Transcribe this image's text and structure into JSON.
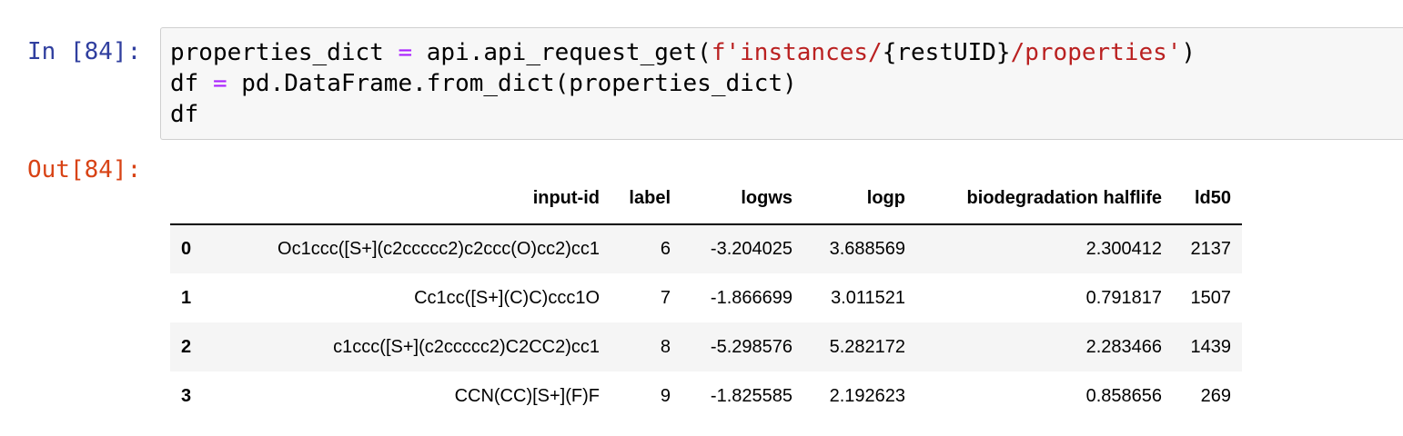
{
  "cell": {
    "in_prompt": "In [84]:",
    "out_prompt": "Out[84]:",
    "code_lines": [
      [
        {
          "t": "properties_dict ",
          "c": "plain"
        },
        {
          "t": "=",
          "c": "op"
        },
        {
          "t": " api.api_request_get(",
          "c": "plain"
        },
        {
          "t": "f'instances/",
          "c": "str"
        },
        {
          "t": "{restUID}",
          "c": "plain"
        },
        {
          "t": "/properties'",
          "c": "str"
        },
        {
          "t": ")",
          "c": "plain"
        }
      ],
      [
        {
          "t": "df ",
          "c": "plain"
        },
        {
          "t": "=",
          "c": "op"
        },
        {
          "t": " pd.DataFrame.from_dict(properties_dict)",
          "c": "plain"
        }
      ],
      [
        {
          "t": "df",
          "c": "plain"
        }
      ]
    ]
  },
  "output_table": {
    "columns": [
      "",
      "input-id",
      "label",
      "logws",
      "logp",
      "biodegradation halflife",
      "ld50"
    ],
    "rows": [
      {
        "index": "0",
        "cells": [
          "Oc1ccc([S+](c2ccccc2)c2ccc(O)cc2)cc1",
          "6",
          "-3.204025",
          "3.688569",
          "2.300412",
          "2137"
        ]
      },
      {
        "index": "1",
        "cells": [
          "Cc1cc([S+](C)C)ccc1O",
          "7",
          "-1.866699",
          "3.011521",
          "0.791817",
          "1507"
        ]
      },
      {
        "index": "2",
        "cells": [
          "c1ccc([S+](c2ccccc2)C2CC2)cc1",
          "8",
          "-5.298576",
          "5.282172",
          "2.283466",
          "1439"
        ]
      },
      {
        "index": "3",
        "cells": [
          "CCN(CC)[S+](F)F",
          "9",
          "-1.825585",
          "2.192623",
          "0.858656",
          "269"
        ]
      }
    ]
  },
  "colors": {
    "in_prompt": "#303f9f",
    "out_prompt": "#d84315",
    "code_operator": "#aa22ff",
    "code_string": "#ba2121",
    "cell_background": "#f7f7f7",
    "row_stripe": "#f5f5f5"
  }
}
